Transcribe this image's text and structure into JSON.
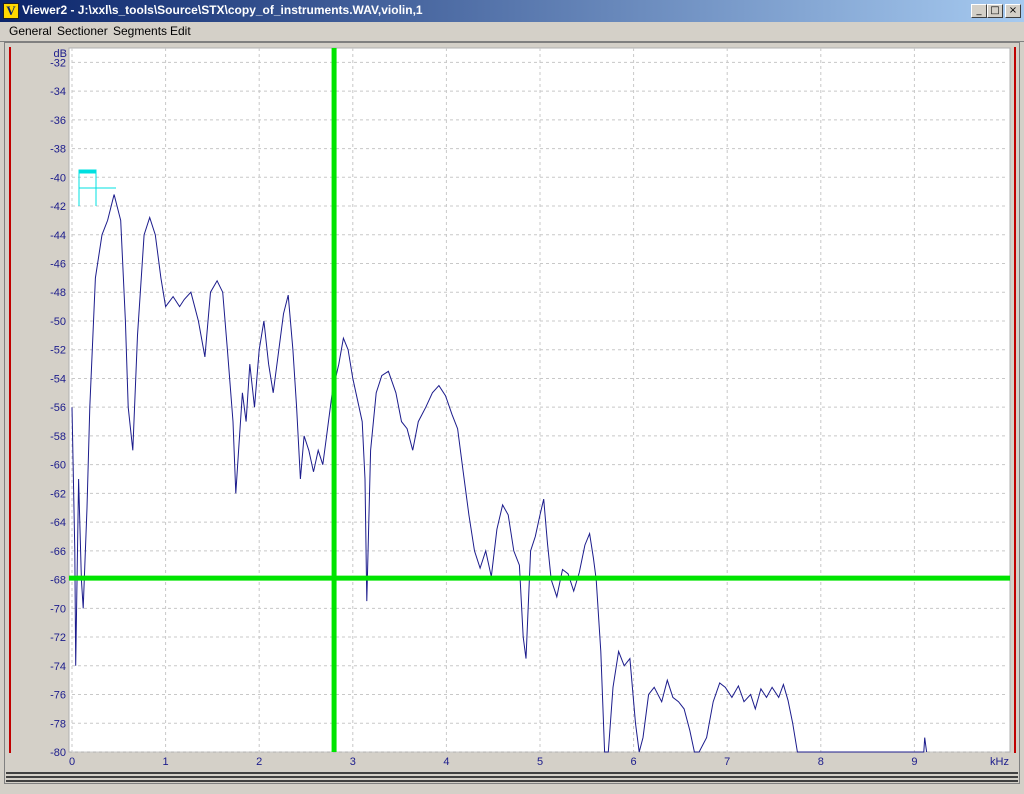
{
  "window": {
    "title": "Viewer2 - J:\\xxl\\s_tools\\Source\\STX\\copy_of_instruments.WAV,violin,1",
    "app_icon_letter": "V",
    "buttons": [
      "_",
      "□",
      "×"
    ]
  },
  "menu": [
    {
      "label": "General"
    },
    {
      "label": "Sectioner"
    },
    {
      "label": "Segments"
    },
    {
      "label": "Edit"
    }
  ],
  "chart_data": {
    "type": "line",
    "xlabel": "kHz",
    "ylabel": "dB",
    "xlim": [
      0,
      10
    ],
    "ylim": [
      -80,
      -31
    ],
    "x_ticks": [
      0,
      1,
      2,
      3,
      4,
      5,
      6,
      7,
      8,
      9
    ],
    "y_ticks": [
      -32,
      -34,
      -36,
      -38,
      -40,
      -42,
      -44,
      -46,
      -48,
      -50,
      -52,
      -54,
      -56,
      -58,
      -60,
      -62,
      -64,
      -66,
      -68,
      -70,
      -72,
      -74,
      -76,
      -78,
      -80
    ],
    "grid": true,
    "line_color": "#1c1c8c",
    "cursor_color": "#00e400",
    "cursor": {
      "x_khz": 2.8,
      "y_db": -67.9
    },
    "series": [
      {
        "points": [
          [
            0,
            -56
          ],
          [
            0.03,
            -66
          ],
          [
            0.04,
            -74
          ],
          [
            0.07,
            -61
          ],
          [
            0.1,
            -68
          ],
          [
            0.12,
            -70
          ],
          [
            0.16,
            -63
          ],
          [
            0.19,
            -56
          ],
          [
            0.25,
            -47
          ],
          [
            0.32,
            -44
          ],
          [
            0.38,
            -43
          ],
          [
            0.45,
            -41.2
          ],
          [
            0.52,
            -43
          ],
          [
            0.57,
            -50
          ],
          [
            0.6,
            -56
          ],
          [
            0.65,
            -59
          ],
          [
            0.7,
            -51
          ],
          [
            0.77,
            -44
          ],
          [
            0.83,
            -42.8
          ],
          [
            0.89,
            -44
          ],
          [
            0.95,
            -47
          ],
          [
            1.0,
            -49
          ],
          [
            1.08,
            -48.3
          ],
          [
            1.15,
            -49
          ],
          [
            1.2,
            -48.5
          ],
          [
            1.27,
            -48
          ],
          [
            1.35,
            -50
          ],
          [
            1.42,
            -52.5
          ],
          [
            1.48,
            -48
          ],
          [
            1.55,
            -47.2
          ],
          [
            1.61,
            -48
          ],
          [
            1.66,
            -52
          ],
          [
            1.72,
            -57
          ],
          [
            1.75,
            -62
          ],
          [
            1.78,
            -59
          ],
          [
            1.82,
            -55
          ],
          [
            1.86,
            -57
          ],
          [
            1.9,
            -53
          ],
          [
            1.95,
            -56
          ],
          [
            2.0,
            -52
          ],
          [
            2.05,
            -50
          ],
          [
            2.1,
            -53
          ],
          [
            2.15,
            -55
          ],
          [
            2.2,
            -52.5
          ],
          [
            2.26,
            -49.5
          ],
          [
            2.31,
            -48.2
          ],
          [
            2.36,
            -52
          ],
          [
            2.4,
            -56
          ],
          [
            2.44,
            -61
          ],
          [
            2.48,
            -58
          ],
          [
            2.53,
            -59
          ],
          [
            2.58,
            -60.5
          ],
          [
            2.63,
            -59
          ],
          [
            2.68,
            -60
          ],
          [
            2.72,
            -58
          ],
          [
            2.78,
            -55
          ],
          [
            2.85,
            -53
          ],
          [
            2.9,
            -51.2
          ],
          [
            2.95,
            -52
          ],
          [
            3.0,
            -54
          ],
          [
            3.05,
            -55.5
          ],
          [
            3.1,
            -57
          ],
          [
            3.13,
            -61
          ],
          [
            3.15,
            -69.5
          ],
          [
            3.19,
            -59
          ],
          [
            3.25,
            -55
          ],
          [
            3.31,
            -53.8
          ],
          [
            3.38,
            -53.5
          ],
          [
            3.46,
            -55
          ],
          [
            3.52,
            -57
          ],
          [
            3.58,
            -57.5
          ],
          [
            3.64,
            -59
          ],
          [
            3.7,
            -57
          ],
          [
            3.78,
            -56
          ],
          [
            3.85,
            -55
          ],
          [
            3.92,
            -54.5
          ],
          [
            3.99,
            -55.2
          ],
          [
            4.06,
            -56.5
          ],
          [
            4.12,
            -57.5
          ],
          [
            4.18,
            -60.5
          ],
          [
            4.24,
            -63.5
          ],
          [
            4.3,
            -66
          ],
          [
            4.36,
            -67.2
          ],
          [
            4.42,
            -66
          ],
          [
            4.48,
            -67.8
          ],
          [
            4.54,
            -64.5
          ],
          [
            4.6,
            -62.8
          ],
          [
            4.66,
            -63.5
          ],
          [
            4.72,
            -66
          ],
          [
            4.78,
            -67
          ],
          [
            4.82,
            -72
          ],
          [
            4.85,
            -73.5
          ],
          [
            4.9,
            -66
          ],
          [
            4.95,
            -65
          ],
          [
            5.0,
            -63.5
          ],
          [
            5.04,
            -62.4
          ],
          [
            5.08,
            -65.5
          ],
          [
            5.12,
            -68
          ],
          [
            5.18,
            -69.2
          ],
          [
            5.24,
            -67.3
          ],
          [
            5.3,
            -67.6
          ],
          [
            5.36,
            -68.8
          ],
          [
            5.42,
            -67.5
          ],
          [
            5.48,
            -65.6
          ],
          [
            5.53,
            -64.8
          ],
          [
            5.57,
            -66.5
          ],
          [
            5.6,
            -68
          ],
          [
            5.65,
            -73
          ],
          [
            5.69,
            -80
          ],
          [
            5.73,
            -80
          ],
          [
            5.78,
            -75.5
          ],
          [
            5.84,
            -73
          ],
          [
            5.9,
            -74
          ],
          [
            5.96,
            -73.5
          ],
          [
            6.02,
            -78
          ],
          [
            6.06,
            -80
          ],
          [
            6.1,
            -79
          ],
          [
            6.16,
            -76
          ],
          [
            6.22,
            -75.5
          ],
          [
            6.3,
            -76.5
          ],
          [
            6.36,
            -75
          ],
          [
            6.42,
            -76.2
          ],
          [
            6.48,
            -76.5
          ],
          [
            6.54,
            -77
          ],
          [
            6.6,
            -78.5
          ],
          [
            6.65,
            -80
          ],
          [
            6.7,
            -80
          ],
          [
            6.78,
            -79
          ],
          [
            6.85,
            -76.5
          ],
          [
            6.92,
            -75.2
          ],
          [
            6.98,
            -75.5
          ],
          [
            7.05,
            -76.2
          ],
          [
            7.12,
            -75.4
          ],
          [
            7.18,
            -76.5
          ],
          [
            7.25,
            -76
          ],
          [
            7.3,
            -77
          ],
          [
            7.36,
            -75.6
          ],
          [
            7.42,
            -76.2
          ],
          [
            7.48,
            -75.5
          ],
          [
            7.55,
            -76.2
          ],
          [
            7.6,
            -75.3
          ],
          [
            7.65,
            -76.4
          ],
          [
            7.7,
            -78
          ],
          [
            7.75,
            -80
          ],
          [
            9.1,
            -80
          ],
          [
            9.11,
            -79
          ],
          [
            9.13,
            -80
          ]
        ]
      }
    ]
  }
}
